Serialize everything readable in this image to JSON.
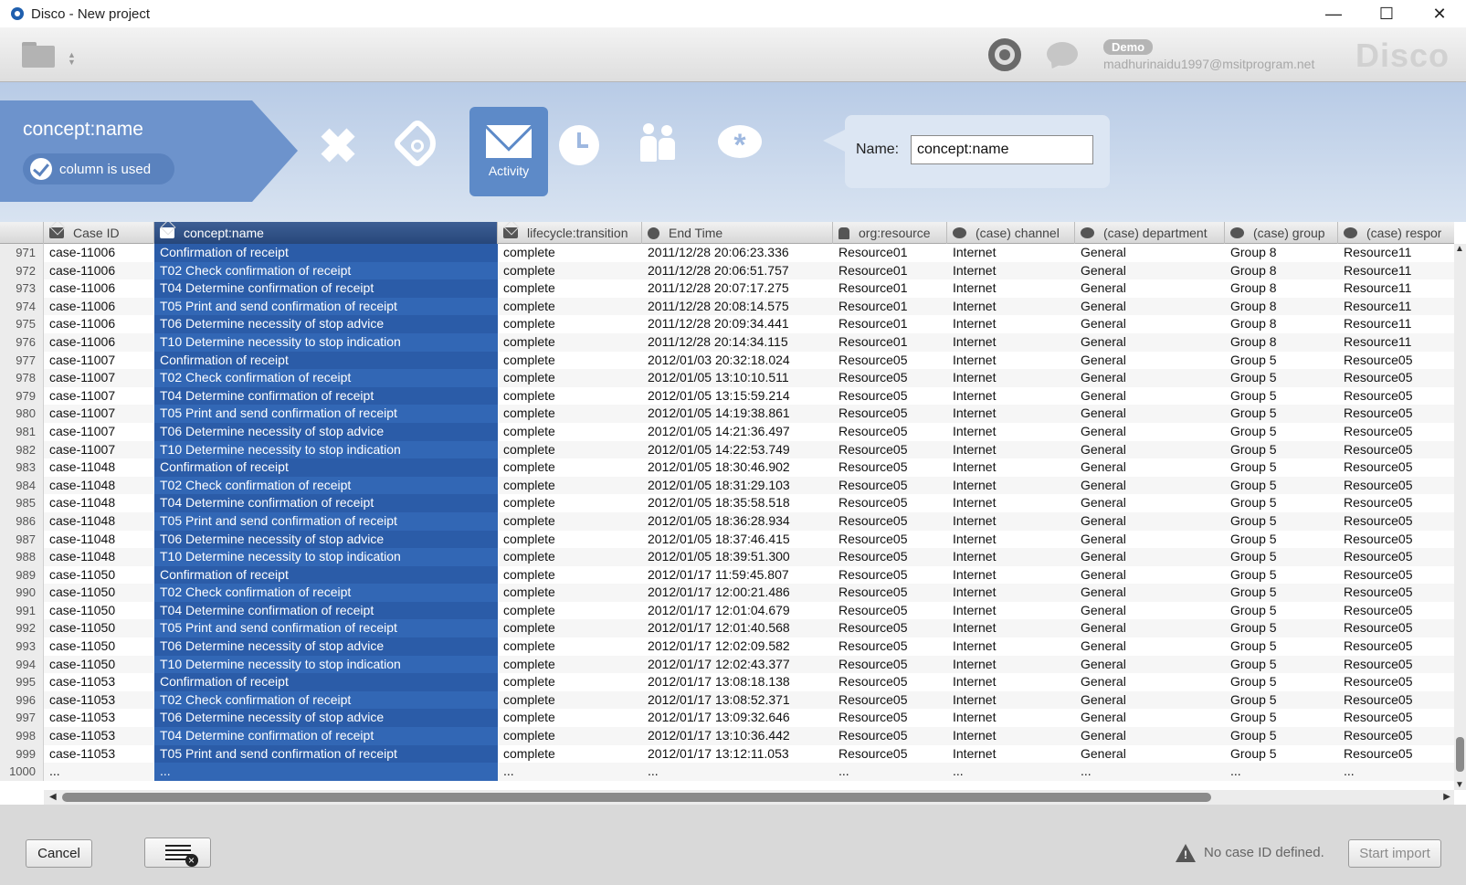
{
  "window": {
    "title": "Disco - New project",
    "minimize": "—",
    "maximize": "☐",
    "close": "✕"
  },
  "toolbar": {
    "demo_badge": "Demo",
    "user_email": "madhurinaidu1997@msitprogram.net",
    "brand": "Disco"
  },
  "column_config": {
    "column_name": "concept:name",
    "used_label": "column is used",
    "active_role_label": "Activity",
    "roles": [
      "remove-icon",
      "tag-icon",
      "envelope-icon",
      "clock-icon",
      "people-icon",
      "chat-icon"
    ],
    "name_label": "Name:",
    "name_value": "concept:name"
  },
  "table": {
    "headers": [
      "Case ID",
      "concept:name",
      "lifecycle:transition",
      "End Time",
      "org:resource",
      "(case) channel",
      "(case) department",
      "(case) group",
      "(case) respor"
    ],
    "rows": [
      [
        "971",
        "case-11006",
        "Confirmation of receipt",
        "complete",
        "2011/12/28 20:06:23.336",
        "Resource01",
        "Internet",
        "General",
        "Group 8",
        "Resource11"
      ],
      [
        "972",
        "case-11006",
        "T02 Check confirmation of receipt",
        "complete",
        "2011/12/28 20:06:51.757",
        "Resource01",
        "Internet",
        "General",
        "Group 8",
        "Resource11"
      ],
      [
        "973",
        "case-11006",
        "T04 Determine confirmation of receipt",
        "complete",
        "2011/12/28 20:07:17.275",
        "Resource01",
        "Internet",
        "General",
        "Group 8",
        "Resource11"
      ],
      [
        "974",
        "case-11006",
        "T05 Print and send confirmation of receipt",
        "complete",
        "2011/12/28 20:08:14.575",
        "Resource01",
        "Internet",
        "General",
        "Group 8",
        "Resource11"
      ],
      [
        "975",
        "case-11006",
        "T06 Determine necessity of stop advice",
        "complete",
        "2011/12/28 20:09:34.441",
        "Resource01",
        "Internet",
        "General",
        "Group 8",
        "Resource11"
      ],
      [
        "976",
        "case-11006",
        "T10 Determine necessity to stop indication",
        "complete",
        "2011/12/28 20:14:34.115",
        "Resource01",
        "Internet",
        "General",
        "Group 8",
        "Resource11"
      ],
      [
        "977",
        "case-11007",
        "Confirmation of receipt",
        "complete",
        "2012/01/03 20:32:18.024",
        "Resource05",
        "Internet",
        "General",
        "Group 5",
        "Resource05"
      ],
      [
        "978",
        "case-11007",
        "T02 Check confirmation of receipt",
        "complete",
        "2012/01/05 13:10:10.511",
        "Resource05",
        "Internet",
        "General",
        "Group 5",
        "Resource05"
      ],
      [
        "979",
        "case-11007",
        "T04 Determine confirmation of receipt",
        "complete",
        "2012/01/05 13:15:59.214",
        "Resource05",
        "Internet",
        "General",
        "Group 5",
        "Resource05"
      ],
      [
        "980",
        "case-11007",
        "T05 Print and send confirmation of receipt",
        "complete",
        "2012/01/05 14:19:38.861",
        "Resource05",
        "Internet",
        "General",
        "Group 5",
        "Resource05"
      ],
      [
        "981",
        "case-11007",
        "T06 Determine necessity of stop advice",
        "complete",
        "2012/01/05 14:21:36.497",
        "Resource05",
        "Internet",
        "General",
        "Group 5",
        "Resource05"
      ],
      [
        "982",
        "case-11007",
        "T10 Determine necessity to stop indication",
        "complete",
        "2012/01/05 14:22:53.749",
        "Resource05",
        "Internet",
        "General",
        "Group 5",
        "Resource05"
      ],
      [
        "983",
        "case-11048",
        "Confirmation of receipt",
        "complete",
        "2012/01/05 18:30:46.902",
        "Resource05",
        "Internet",
        "General",
        "Group 5",
        "Resource05"
      ],
      [
        "984",
        "case-11048",
        "T02 Check confirmation of receipt",
        "complete",
        "2012/01/05 18:31:29.103",
        "Resource05",
        "Internet",
        "General",
        "Group 5",
        "Resource05"
      ],
      [
        "985",
        "case-11048",
        "T04 Determine confirmation of receipt",
        "complete",
        "2012/01/05 18:35:58.518",
        "Resource05",
        "Internet",
        "General",
        "Group 5",
        "Resource05"
      ],
      [
        "986",
        "case-11048",
        "T05 Print and send confirmation of receipt",
        "complete",
        "2012/01/05 18:36:28.934",
        "Resource05",
        "Internet",
        "General",
        "Group 5",
        "Resource05"
      ],
      [
        "987",
        "case-11048",
        "T06 Determine necessity of stop advice",
        "complete",
        "2012/01/05 18:37:46.415",
        "Resource05",
        "Internet",
        "General",
        "Group 5",
        "Resource05"
      ],
      [
        "988",
        "case-11048",
        "T10 Determine necessity to stop indication",
        "complete",
        "2012/01/05 18:39:51.300",
        "Resource05",
        "Internet",
        "General",
        "Group 5",
        "Resource05"
      ],
      [
        "989",
        "case-11050",
        "Confirmation of receipt",
        "complete",
        "2012/01/17 11:59:45.807",
        "Resource05",
        "Internet",
        "General",
        "Group 5",
        "Resource05"
      ],
      [
        "990",
        "case-11050",
        "T02 Check confirmation of receipt",
        "complete",
        "2012/01/17 12:00:21.486",
        "Resource05",
        "Internet",
        "General",
        "Group 5",
        "Resource05"
      ],
      [
        "991",
        "case-11050",
        "T04 Determine confirmation of receipt",
        "complete",
        "2012/01/17 12:01:04.679",
        "Resource05",
        "Internet",
        "General",
        "Group 5",
        "Resource05"
      ],
      [
        "992",
        "case-11050",
        "T05 Print and send confirmation of receipt",
        "complete",
        "2012/01/17 12:01:40.568",
        "Resource05",
        "Internet",
        "General",
        "Group 5",
        "Resource05"
      ],
      [
        "993",
        "case-11050",
        "T06 Determine necessity of stop advice",
        "complete",
        "2012/01/17 12:02:09.582",
        "Resource05",
        "Internet",
        "General",
        "Group 5",
        "Resource05"
      ],
      [
        "994",
        "case-11050",
        "T10 Determine necessity to stop indication",
        "complete",
        "2012/01/17 12:02:43.377",
        "Resource05",
        "Internet",
        "General",
        "Group 5",
        "Resource05"
      ],
      [
        "995",
        "case-11053",
        "Confirmation of receipt",
        "complete",
        "2012/01/17 13:08:18.138",
        "Resource05",
        "Internet",
        "General",
        "Group 5",
        "Resource05"
      ],
      [
        "996",
        "case-11053",
        "T02 Check confirmation of receipt",
        "complete",
        "2012/01/17 13:08:52.371",
        "Resource05",
        "Internet",
        "General",
        "Group 5",
        "Resource05"
      ],
      [
        "997",
        "case-11053",
        "T06 Determine necessity of stop advice",
        "complete",
        "2012/01/17 13:09:32.646",
        "Resource05",
        "Internet",
        "General",
        "Group 5",
        "Resource05"
      ],
      [
        "998",
        "case-11053",
        "T04 Determine confirmation of receipt",
        "complete",
        "2012/01/17 13:10:36.442",
        "Resource05",
        "Internet",
        "General",
        "Group 5",
        "Resource05"
      ],
      [
        "999",
        "case-11053",
        "T05 Print and send confirmation of receipt",
        "complete",
        "2012/01/17 13:12:11.053",
        "Resource05",
        "Internet",
        "General",
        "Group 5",
        "Resource05"
      ],
      [
        "1000",
        "...",
        "...",
        "...",
        "...",
        "...",
        "...",
        "...",
        "...",
        "..."
      ]
    ]
  },
  "footer": {
    "cancel_label": "Cancel",
    "warning_text": "No case ID defined.",
    "start_label": "Start import"
  },
  "colors": {
    "accent": "#2b5ca8",
    "panel": "#6d93cc",
    "active_role": "#5d8ac8"
  }
}
